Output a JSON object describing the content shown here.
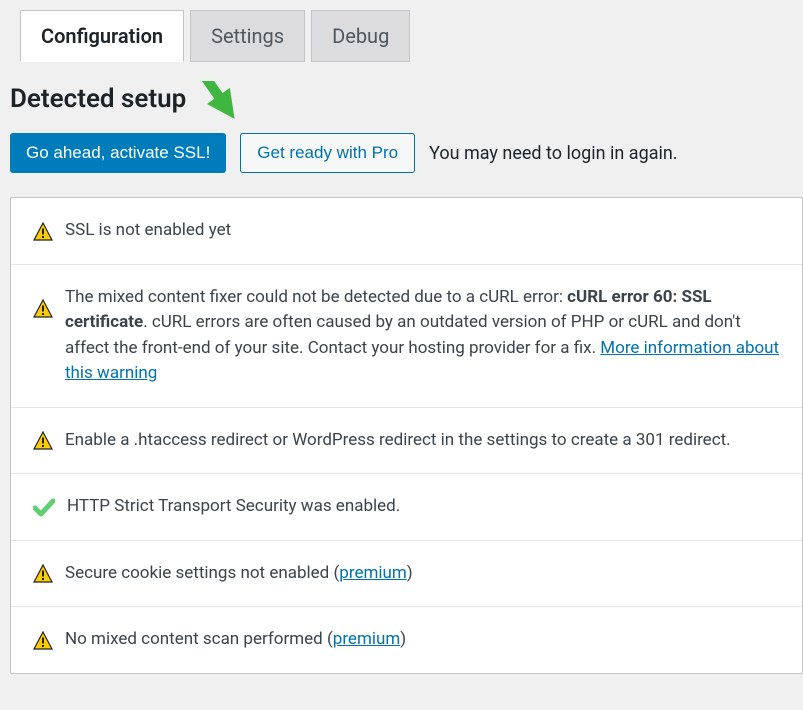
{
  "tabs": {
    "configuration": "Configuration",
    "settings": "Settings",
    "debug": "Debug"
  },
  "heading": "Detected setup",
  "actions": {
    "activate_label": "Go ahead, activate SSL!",
    "pro_label": "Get ready with Pro",
    "note": "You may need to login in again."
  },
  "rows": {
    "not_enabled": "SSL is not enabled yet",
    "mixed_pre": "The mixed content fixer could not be detected due to a cURL error: ",
    "mixed_bold": "cURL error 60: SSL certificate",
    "mixed_post": ". cURL errors are often caused by an outdated version of PHP or cURL and don't affect the front-end of your site. Contact your hosting provider for a fix. ",
    "mixed_link": "More information about this warning",
    "htaccess": "Enable a .htaccess redirect or WordPress redirect in the settings to create a 301 redirect.",
    "hsts": "HTTP Strict Transport Security was enabled.",
    "cookie_pre": "Secure cookie settings not enabled (",
    "cookie_link": "premium",
    "cookie_post": ")",
    "scan_pre": "No mixed content scan performed (",
    "scan_link": "premium",
    "scan_post": ")"
  }
}
